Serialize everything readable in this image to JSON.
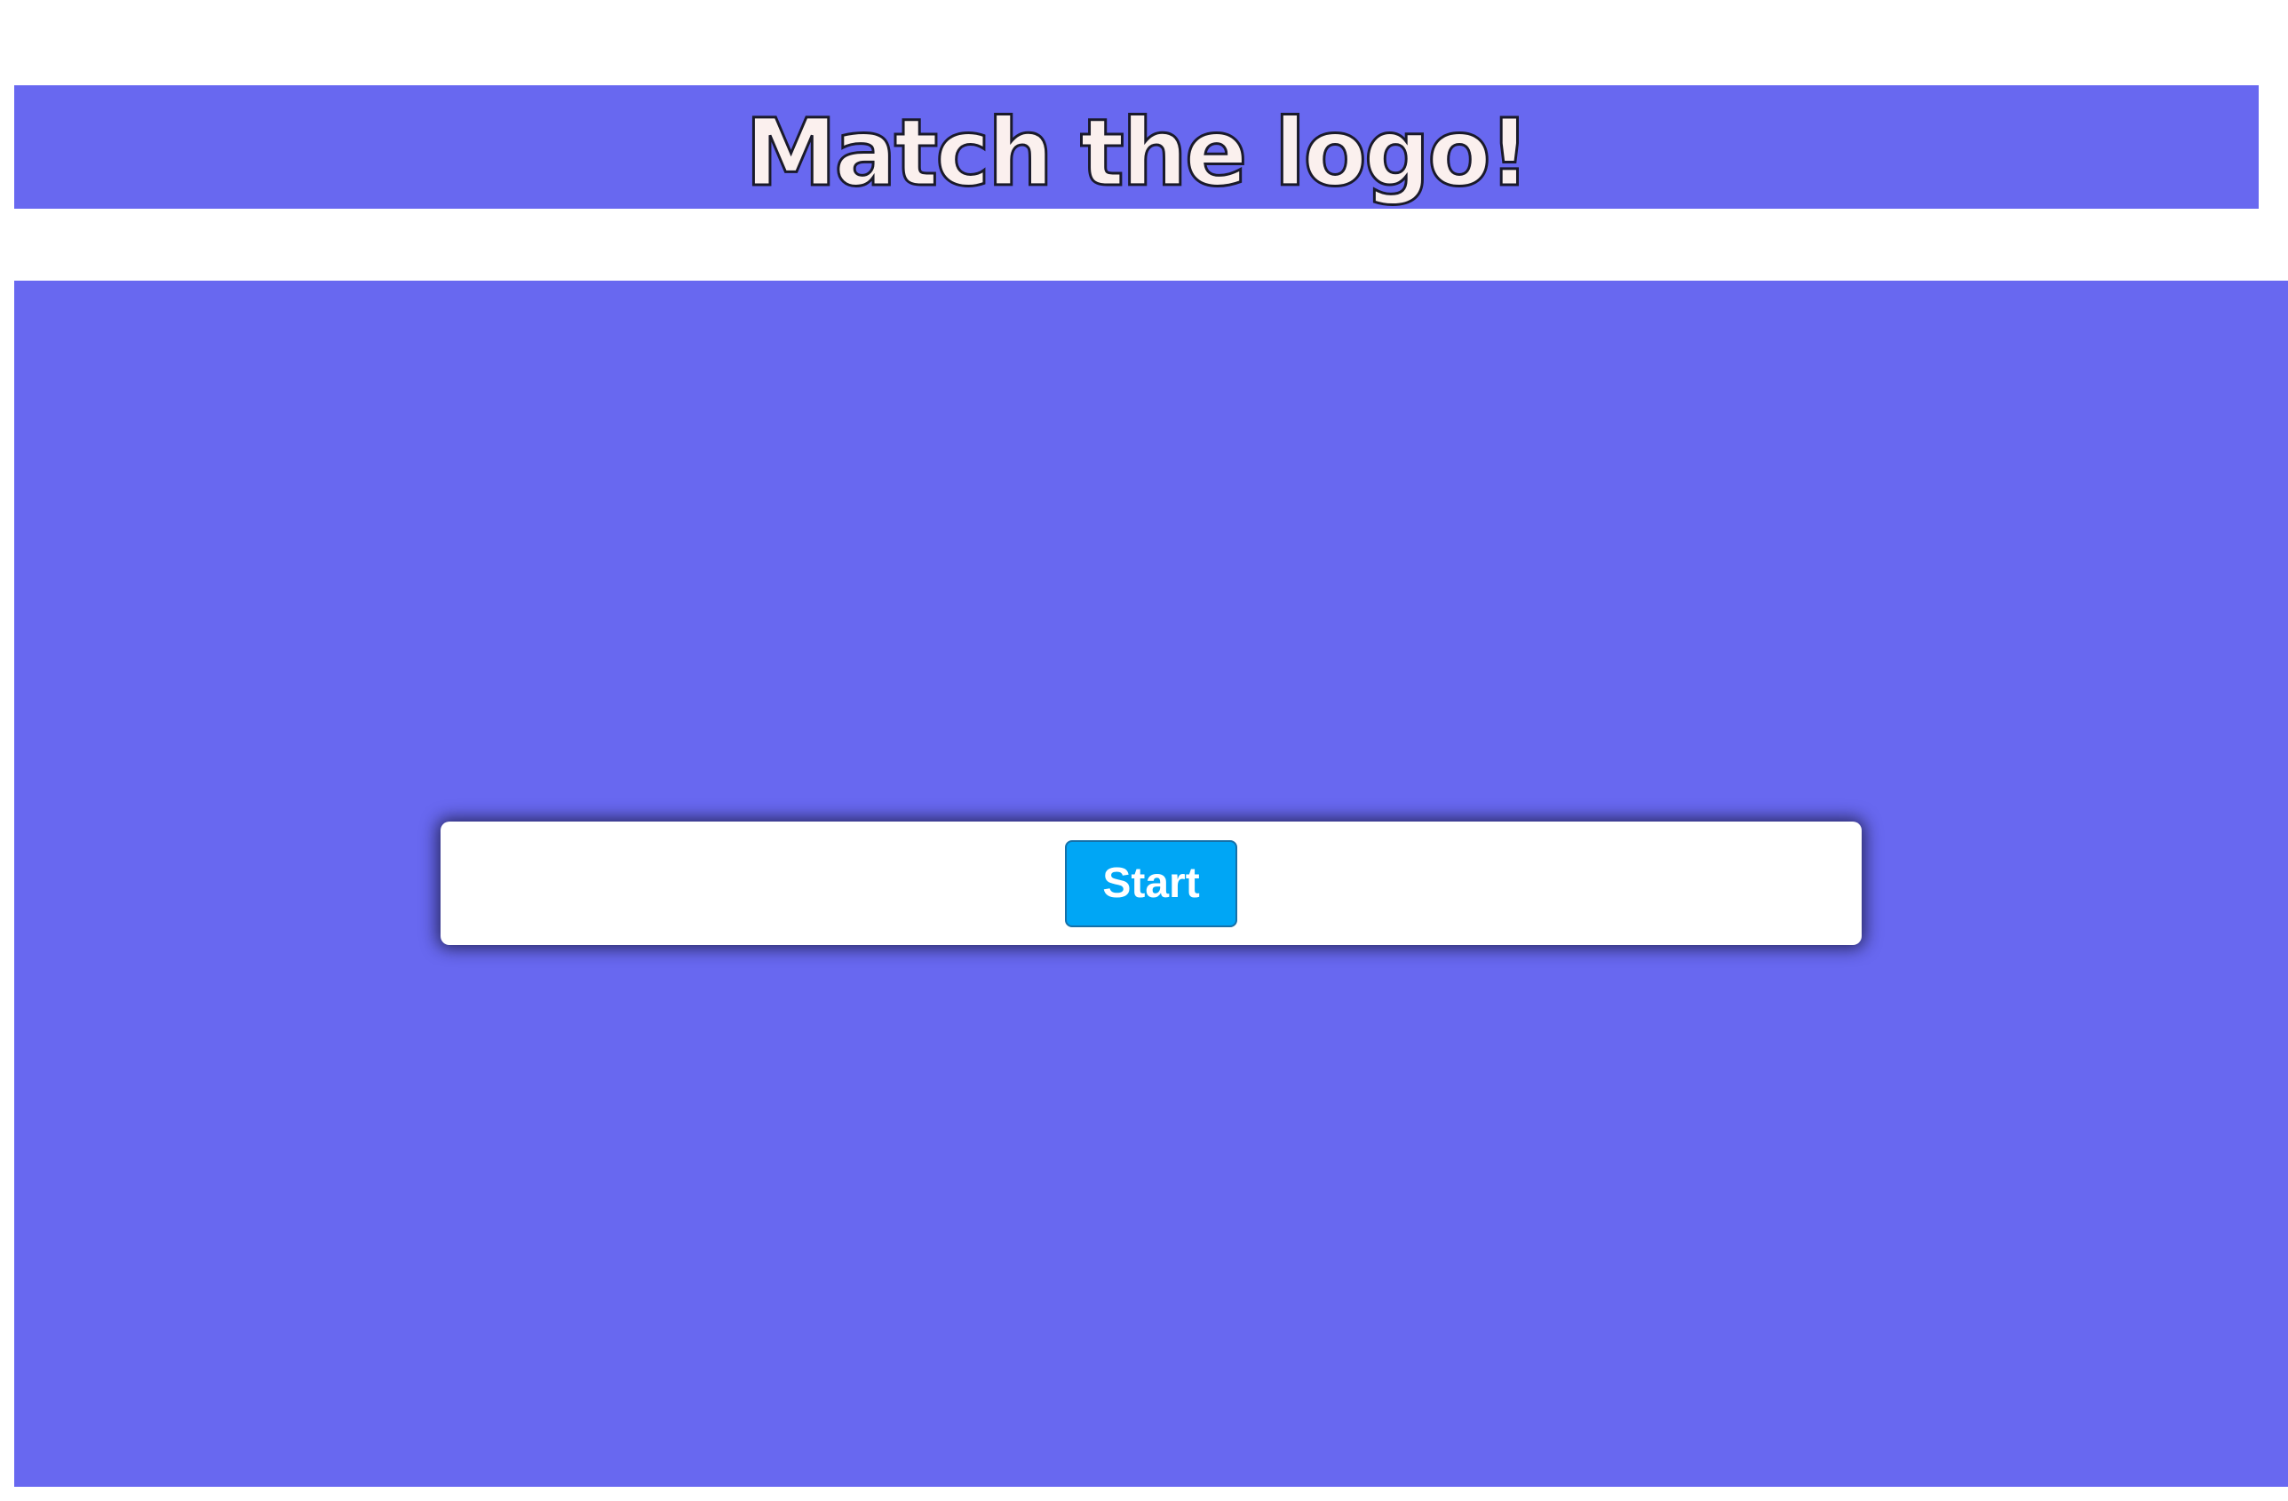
{
  "header": {
    "title": "Match the logo!"
  },
  "start_panel": {
    "start_label": "Start"
  },
  "colors": {
    "primary_background": "#6868f0",
    "button": "#00a6f5",
    "title_fill": "#fbf0ee"
  }
}
